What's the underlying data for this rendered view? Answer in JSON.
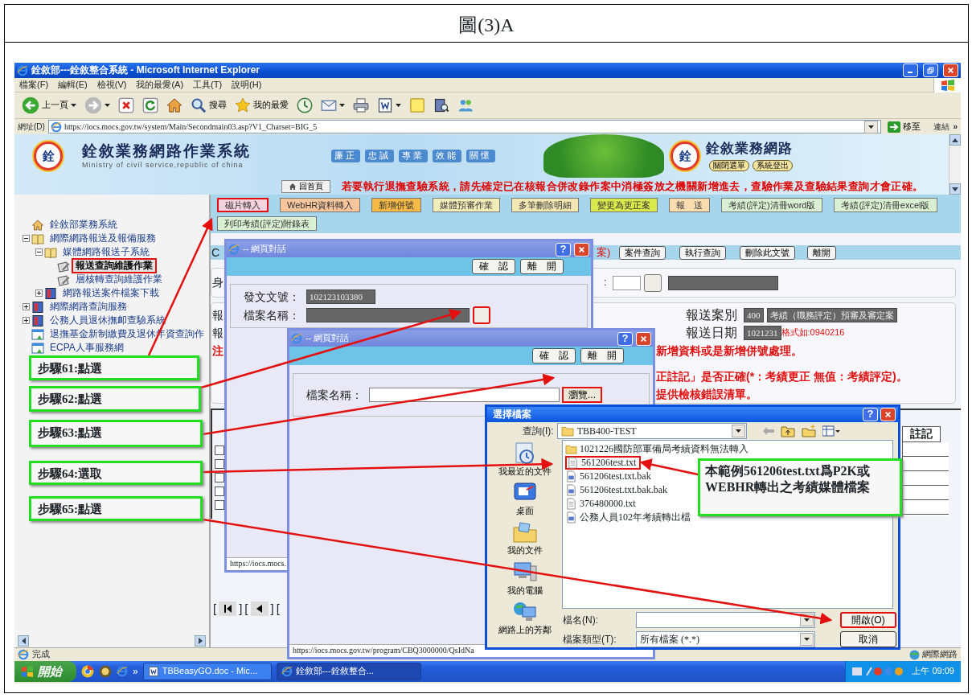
{
  "document_title": "圖(3)A",
  "browser": {
    "title": "銓敘部---銓敘整合系統 - Microsoft Internet Explorer",
    "menu": [
      "檔案(F)",
      "編輯(E)",
      "檢視(V)",
      "我的最愛(A)",
      "工具(T)",
      "說明(H)"
    ],
    "toolbar": [
      {
        "kind": "back",
        "label": "上一頁"
      },
      {
        "kind": "forward"
      },
      {
        "kind": "stop"
      },
      {
        "kind": "refresh"
      },
      {
        "kind": "home"
      },
      {
        "kind": "search",
        "label": "搜尋"
      },
      {
        "kind": "favorites",
        "label": "我的最愛"
      },
      {
        "kind": "history"
      },
      {
        "kind": "mail"
      },
      {
        "kind": "print"
      },
      {
        "kind": "word"
      },
      {
        "kind": "note"
      },
      {
        "kind": "research"
      },
      {
        "kind": "messenger"
      }
    ],
    "address_label": "網址(D)",
    "address": "https://iocs.mocs.gov.tw/system/Main/Secondmain03.asp?V1_Charset=BIG_5",
    "go": "移至",
    "links": "連結",
    "links_more": "»"
  },
  "banner": {
    "logo_char": "銓",
    "title": "銓敘業務網路作業系統",
    "subtitle": "Ministry of civil service,republic of china",
    "motto": [
      "廉正",
      "忠誠",
      "專業",
      "效能",
      "關懷"
    ],
    "right_logo_char": "銓",
    "right_title": "銓敘業務網路",
    "close_menu": "關閉選單",
    "logout": "系統登出",
    "home": "回首頁",
    "notice": "若要執行退撫查驗系統，請先確定已在核報合併改錄作案中消極簽放之機關新增進去，查驗作業及查驗結果查詢才會正確。"
  },
  "functions": [
    [
      {
        "label": "磁片轉入",
        "color": "#f4d3de",
        "highlighted": true
      },
      {
        "label": "WebHR資料轉入",
        "color": "#f7c59c",
        "highlighted": false
      },
      {
        "label": "新增併號",
        "color": "#f5b945",
        "highlighted": false
      },
      {
        "label": "媒體預審作業",
        "color": "#f4edb8",
        "highlighted": false
      },
      {
        "label": "多筆刪除明細",
        "color": "#f3e8b4",
        "highlighted": false
      },
      {
        "label": "變更為更正案",
        "color": "#d9ea4c",
        "highlighted": false
      },
      {
        "label": "報　送",
        "color": "#f9dcb0",
        "highlighted": false
      },
      {
        "label": "考績(評定)清冊word版",
        "color": "#d9f1d2",
        "highlighted": false
      },
      {
        "label": "考績(評定)清冊excel版",
        "color": "#d9f1d2",
        "highlighted": false
      }
    ],
    [
      {
        "label": "列印考績(評定)附錄表",
        "color": "#d9f1d2",
        "highlighted": false
      }
    ]
  ],
  "sidebar": {
    "tree": [
      {
        "kind": "home",
        "label": "銓敘部業務系統",
        "selected": false,
        "highlighted": false
      },
      {
        "kind": "book",
        "label": "網際網路報送及報備服務",
        "expanded": true,
        "selected": false,
        "highlighted": false,
        "children": [
          {
            "kind": "book",
            "label": "媒體網路報送子系統",
            "expanded": true,
            "selected": false,
            "highlighted": false,
            "children": [
              {
                "kind": "page",
                "label": "報送查詢維護作業",
                "selected": true,
                "highlighted": true
              },
              {
                "kind": "page",
                "label": "層核轉查詢維護作業",
                "selected": false,
                "highlighted": false
              }
            ]
          },
          {
            "kind": "redbook",
            "label": "網路報送案件檔案下載",
            "expanded": false,
            "selected": false,
            "highlighted": false
          }
        ]
      },
      {
        "kind": "redbook",
        "label": "網際網路查詢服務",
        "expanded": false,
        "selected": false,
        "highlighted": false
      },
      {
        "kind": "redbook",
        "label": "公務人員退休撫卹查驗系統",
        "expanded": false,
        "selected": false,
        "highlighted": false
      },
      {
        "kind": "link",
        "label": "退撫基金新制繳費及退休年資查詢作",
        "selected": false,
        "highlighted": false
      },
      {
        "kind": "link",
        "label": "ECPA人事服務網",
        "selected": false,
        "highlighted": false
      }
    ]
  },
  "form": {
    "letter": "C",
    "title_end": "案)",
    "actions": [
      "案件查詢",
      "執行查詢",
      "刪除此文號",
      "離開"
    ],
    "row1_prefix": "身",
    "colon": ":",
    "row2_prefix": "報",
    "case_type_label": "報送案別",
    "case_type_code": "400",
    "case_type_name": "考績（職務評定）預審及審定案",
    "row3_prefix": "報",
    "date_label": "報送日期",
    "date": "1021231",
    "date_hint": "格式如:0940216",
    "note_prefix": "注",
    "notes": [
      "新增資料或是新增併號處理。",
      "正註記」是否正確(*：考績更正 無值：考績評定)。",
      "提供檢核錯誤清單。"
    ]
  },
  "table": {
    "column_label": "註記",
    "rows": [
      {
        "checked": false
      },
      {
        "checked": false
      },
      {
        "checked": false
      },
      {
        "checked": false
      },
      {
        "checked": false
      }
    ]
  },
  "pager": [
    {
      "kind": "bracket",
      "text": "["
    },
    {
      "kind": "first"
    },
    {
      "kind": "bracket",
      "text": "]"
    },
    {
      "kind": "bracket",
      "text": "["
    },
    {
      "kind": "prev"
    },
    {
      "kind": "bracket",
      "text": "]"
    },
    {
      "kind": "bracket",
      "text": "["
    }
  ],
  "dialog_1": {
    "title": "-- 網頁對話",
    "help": "?",
    "confirm": "確　認",
    "leave": "離　開",
    "doc_no_label": "發文文號：",
    "doc_no": "102123103380",
    "file_label": "檔案名稱：",
    "pick_highlighted": true,
    "status": "https://iocs.mocs."
  },
  "dialog_2": {
    "title": "-- 網頁對話",
    "help": "?",
    "confirm": "確　認",
    "leave": "離　開",
    "file_label": "檔案名稱：",
    "browse": "瀏覽...",
    "browse_highlighted": true,
    "status": "https://iocs.mocs.gov.tw/program/CBQ3000000/QsIdNa"
  },
  "file_dialog": {
    "title": "選擇檔案",
    "help": "?",
    "look_in_label": "查詢(I):",
    "look_in": "TBB400-TEST",
    "places": [
      {
        "kind": "recent",
        "label": "我最近的文件"
      },
      {
        "kind": "desktop",
        "label": "桌面"
      },
      {
        "kind": "documents",
        "label": "我的文件"
      },
      {
        "kind": "computer",
        "label": "我的電腦"
      },
      {
        "kind": "network",
        "label": "網路上的芳鄰"
      }
    ],
    "files": [
      {
        "kind": "folder",
        "name": "1021226國防部軍備局考績資料無法轉入",
        "highlighted": false
      },
      {
        "kind": "text",
        "name": "561206test.txt",
        "highlighted": true
      },
      {
        "kind": "data",
        "name": "561206test.txt.bak",
        "highlighted": false
      },
      {
        "kind": "data",
        "name": "561206test.txt.bak.bak",
        "highlighted": false
      },
      {
        "kind": "text",
        "name": "376480000.txt",
        "highlighted": false
      },
      {
        "kind": "data",
        "name": "公務人員102年考績轉出檔",
        "highlighted": false
      }
    ],
    "file_name_label": "檔名(N):",
    "file_type_label": "檔案類型(T):",
    "file_type": "所有檔案 (*.*)",
    "open": "開啟(O)",
    "open_highlighted": true,
    "cancel": "取消"
  },
  "callouts": [
    "步驟61:點選",
    "步驟62:點選",
    "步驟63:點選",
    "步驟64:選取",
    "步驟65:點選",
    "本範例561206test.txt爲P2K或WEBHR轉出之考績媒體檔案"
  ],
  "status_bar": {
    "text": "完成",
    "zone": "網際網路"
  },
  "taskbar": {
    "start": "開始",
    "quick_more": "»",
    "tasks": [
      {
        "label": "TBBeasyGO.doc - Mic...",
        "selected": false
      },
      {
        "label": "銓敘部---銓敘整合...",
        "selected": true
      }
    ],
    "clock": "上午 09:09"
  }
}
